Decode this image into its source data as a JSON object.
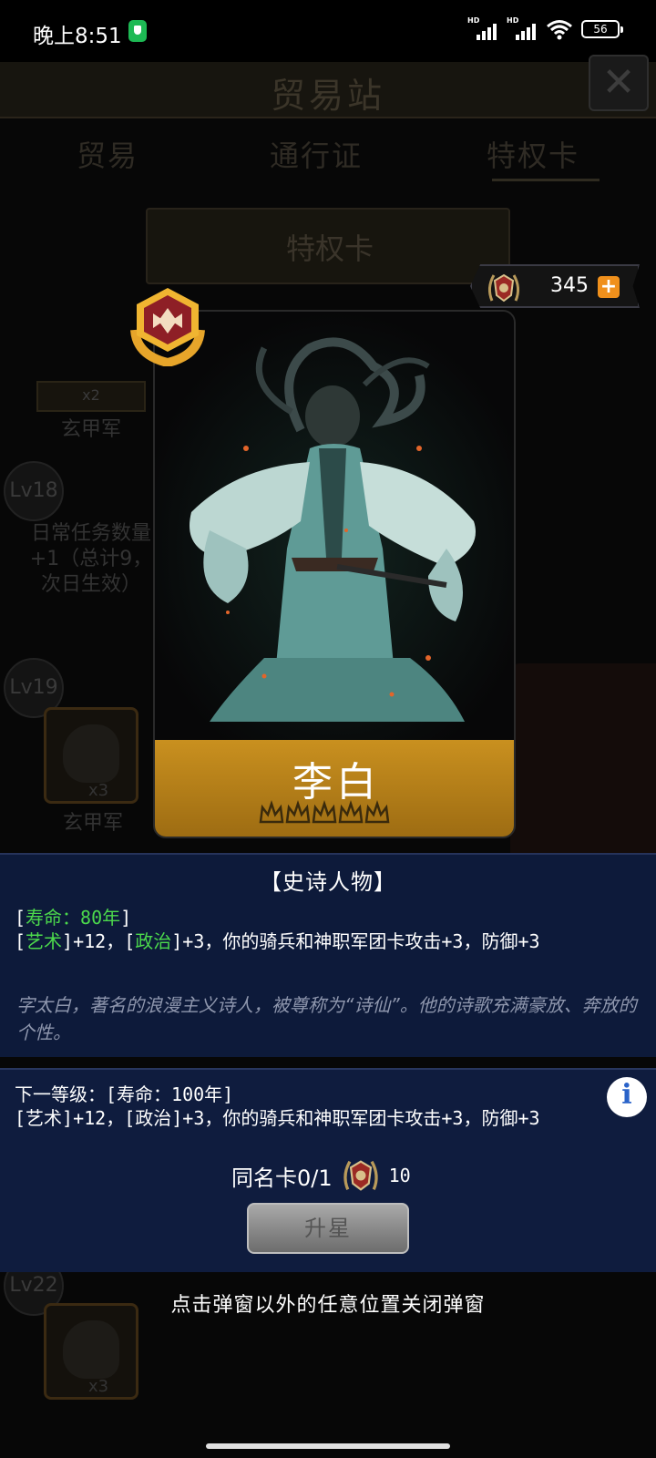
{
  "status_bar": {
    "time": "晚上8:51",
    "signal_label": "HD",
    "battery": "56"
  },
  "background": {
    "title": "贸易站",
    "tabs": [
      "贸易",
      "通行证",
      "特权卡"
    ],
    "banner_title": "特权卡",
    "left_items": [
      {
        "count": "x2",
        "name": "玄甲军"
      },
      {
        "level": "Lv18",
        "text": "日常任务数量+1（总计9，次日生效）"
      },
      {
        "level": "Lv19",
        "count": "x3",
        "name": "玄甲军"
      },
      {
        "level": "Lv22",
        "count": "x3"
      }
    ]
  },
  "currency": {
    "value": "345",
    "plus": "+"
  },
  "card": {
    "name": "李白",
    "stars": 5
  },
  "info": {
    "title": "【史诗人物】",
    "lifespan_prefix": "[",
    "lifespan": "寿命：80年",
    "lifespan_suffix": "]",
    "effect_art": "艺术",
    "effect_art_value": "]+12，[",
    "effect_politics": "政治",
    "effect_rest": "]+3，你的骑兵和神职军团卡攻击+3，防御+3",
    "flavor": "字太白，著名的浪漫主义诗人，被尊称为“诗仙”。他的诗歌充满豪放、奔放的个性。"
  },
  "next_level": {
    "line1": "下一等级：[寿命：100年]",
    "line2": "[艺术]+12，[政治]+3，你的骑兵和神职军团卡攻击+3，防御+3",
    "info_icon": "i",
    "same_card_label": "同名卡0/1",
    "same_card_cost": "10",
    "upgrade_label": "升星"
  },
  "close_hint": "点击弹窗以外的任意位置关闭弹窗"
}
